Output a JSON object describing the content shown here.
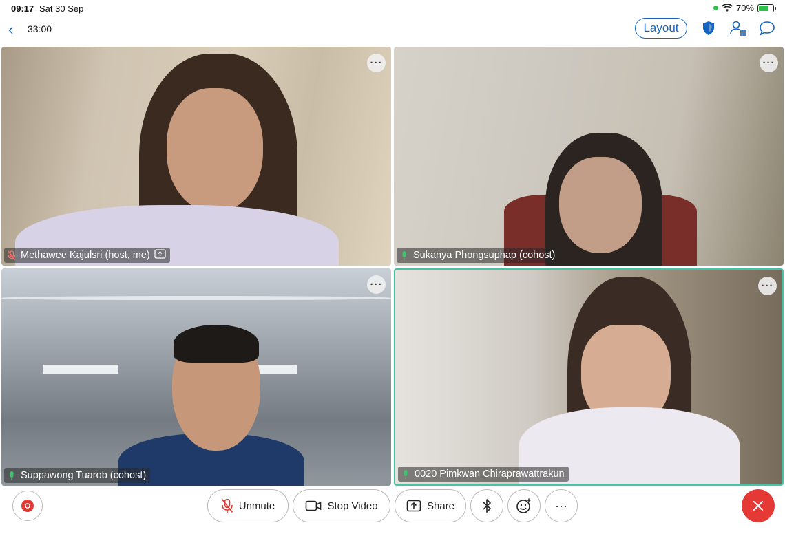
{
  "status": {
    "time": "09:17",
    "date": "Sat 30 Sep",
    "battery": "70%"
  },
  "topbar": {
    "timer": "33:00",
    "layout_label": "Layout"
  },
  "tiles": [
    {
      "name": "Methawee Kajulsri (host, me)",
      "muted": true
    },
    {
      "name": "Sukanya Phongsuphap (cohost)",
      "muted": false
    },
    {
      "name": "Suppawong Tuarob (cohost)",
      "muted": false
    },
    {
      "name": "0020 Pimkwan Chiraprawattrakun",
      "muted": false,
      "active_speaker": true
    }
  ],
  "toolbar": {
    "unmute_label": "Unmute",
    "stop_video_label": "Stop Video",
    "share_label": "Share",
    "more_label": "···"
  },
  "icons": {
    "accent": "#1565c0",
    "end_call": "#e53935",
    "active_border": "#45c3a6"
  }
}
